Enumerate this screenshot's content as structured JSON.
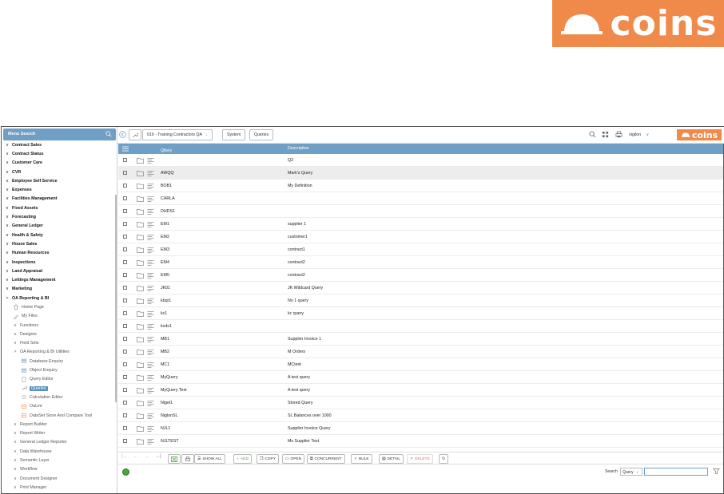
{
  "logo": {
    "word": "coins"
  },
  "sidebar": {
    "search_label": "Menu Search",
    "items": [
      {
        "label": "Contract Sales",
        "level": 0,
        "chev": "∨"
      },
      {
        "label": "Contract Status",
        "level": 0,
        "chev": "∨"
      },
      {
        "label": "Customer Care",
        "level": 0,
        "chev": "∨"
      },
      {
        "label": "CVR",
        "level": 0,
        "chev": "∨"
      },
      {
        "label": "Employee Self Service",
        "level": 0,
        "chev": "∨"
      },
      {
        "label": "Expenses",
        "level": 0,
        "chev": "∨"
      },
      {
        "label": "Facilities Management",
        "level": 0,
        "chev": "∨"
      },
      {
        "label": "Fixed Assets",
        "level": 0,
        "chev": "∨"
      },
      {
        "label": "Forecasting",
        "level": 0,
        "chev": "∨"
      },
      {
        "label": "General Ledger",
        "level": 0,
        "chev": "∨"
      },
      {
        "label": "Health & Safety",
        "level": 0,
        "chev": "∨"
      },
      {
        "label": "House Sales",
        "level": 0,
        "chev": "∨"
      },
      {
        "label": "Human Resources",
        "level": 0,
        "chev": "∨"
      },
      {
        "label": "Inspections",
        "level": 0,
        "chev": "∨"
      },
      {
        "label": "Land Appraisal",
        "level": 0,
        "chev": "∨"
      },
      {
        "label": "Lettings Management",
        "level": 0,
        "chev": "∨"
      },
      {
        "label": "Marketing",
        "level": 0,
        "chev": "∨"
      },
      {
        "label": "OA Reporting & BI",
        "level": 0,
        "chev": ">"
      },
      {
        "label": "Home Page",
        "level": 1,
        "icon": "home-icon"
      },
      {
        "label": "My Files",
        "level": 1,
        "icon": "pencil-icon"
      },
      {
        "label": "Functions",
        "level": 1,
        "chev": "∨"
      },
      {
        "label": "Designer",
        "level": 1,
        "chev": "∨"
      },
      {
        "label": "Field Sets",
        "level": 1,
        "chev": "∨"
      },
      {
        "label": "OA Reporting & BI Utilities",
        "level": 1,
        "chev": ">"
      },
      {
        "label": "Database Enquiry",
        "level": 2,
        "icon": "table-icon"
      },
      {
        "label": "Object Enquiry",
        "level": 2,
        "icon": "table-icon"
      },
      {
        "label": "Query Editor",
        "level": 2,
        "icon": "document-icon"
      },
      {
        "label": "Queries",
        "level": 2,
        "icon": "wrench-icon",
        "active": true
      },
      {
        "label": "Calculation Editor",
        "level": 2,
        "icon": "calc-icon"
      },
      {
        "label": "OaLint",
        "level": 2,
        "icon": "orange-box-icon"
      },
      {
        "label": "DataSet Store And Compare Tool",
        "level": 2,
        "icon": "orange-box-icon"
      },
      {
        "label": "Report Builder",
        "level": 1,
        "chev": "∨"
      },
      {
        "label": "Report Writer",
        "level": 1,
        "chev": "∨"
      },
      {
        "label": "General Ledger Reporter",
        "level": 1,
        "chev": "∨"
      },
      {
        "label": "Data Warehouse",
        "level": 1,
        "chev": "∨"
      },
      {
        "label": "Semantic Layer",
        "level": 1,
        "chev": "∨"
      },
      {
        "label": "Workflow",
        "level": 1,
        "chev": "∨"
      },
      {
        "label": "Document Designer",
        "level": 1,
        "chev": "∨"
      },
      {
        "label": "Print Manager",
        "level": 1,
        "chev": "∨"
      }
    ]
  },
  "topbar": {
    "company": "010 - Training Contractors QA",
    "breadcrumb_system": "System",
    "breadcrumb_queries": "Queries",
    "user": "nigilon"
  },
  "grid": {
    "col_query": "Query",
    "col_description": "Description",
    "rows": [
      {
        "query": "",
        "description": "Q2"
      },
      {
        "query": "AWQQ",
        "description": "Mark's Query"
      },
      {
        "query": "BOB1",
        "description": "My Definition"
      },
      {
        "query": "CARLA",
        "description": ""
      },
      {
        "query": "DHDS1",
        "description": ""
      },
      {
        "query": "EM1",
        "description": "supplier 1"
      },
      {
        "query": "EM2",
        "description": "customer1"
      },
      {
        "query": "EM3",
        "description": "contract1"
      },
      {
        "query": "EM4",
        "description": "contract2"
      },
      {
        "query": "EM5",
        "description": "contract2"
      },
      {
        "query": "JK01",
        "description": "JK Wildcard Query"
      },
      {
        "query": "kbqr1",
        "description": "No 1 query"
      },
      {
        "query": "kc1",
        "description": "kc query"
      },
      {
        "query": "kcds1",
        "description": ""
      },
      {
        "query": "MB1",
        "description": "Supplier Invoice 1"
      },
      {
        "query": "MB2",
        "description": "M Orders"
      },
      {
        "query": "MC1",
        "description": "MCtest"
      },
      {
        "query": "MyQuery",
        "description": "A test query"
      },
      {
        "query": "MyQuery Test",
        "description": "A test query"
      },
      {
        "query": "Nigel1",
        "description": "Stored Query"
      },
      {
        "query": "NiglonSL",
        "description": "SL Balances over 1000"
      },
      {
        "query": "NJL1",
        "description": "Supplier Invoice Query"
      },
      {
        "query": "NJLTEST",
        "description": "Ms Supplier Test"
      }
    ]
  },
  "toolbar": {
    "show_all": "SHOW ALL",
    "add": "ADD",
    "copy": "COPY",
    "open": "OPEN",
    "concurrent": "CONCURRENT",
    "bulk": "BULK",
    "detail": "DETAIL",
    "delete": "DELETE"
  },
  "bottombar": {
    "search_label": "Search",
    "search_field": "Query",
    "search_value": ""
  },
  "colors": {
    "brand_orange": "#f08a4b",
    "header_blue": "#6f9fc5",
    "add_green": "#56a047",
    "delete_red": "#e07070"
  }
}
